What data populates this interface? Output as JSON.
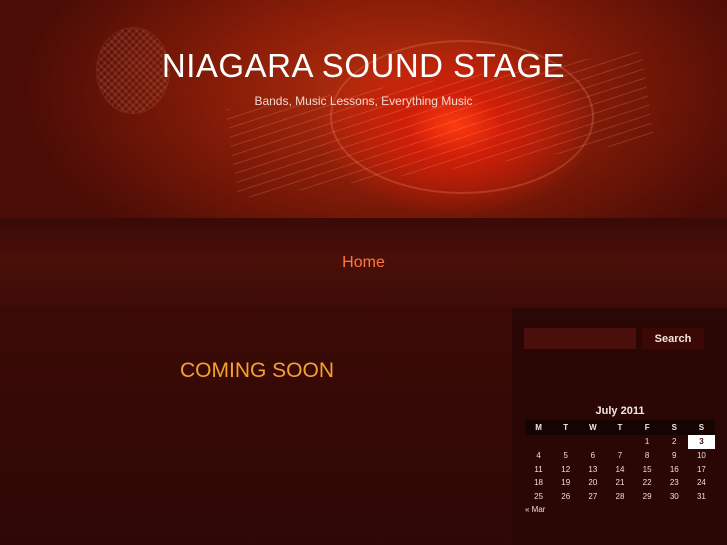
{
  "site": {
    "title": "NIAGARA SOUND STAGE",
    "tagline": "Bands, Music Lessons, Everything Music"
  },
  "nav": {
    "home_label": "Home"
  },
  "main": {
    "heading": "COMING SOON"
  },
  "search": {
    "button_label": "Search",
    "value": ""
  },
  "calendar": {
    "caption": "July 2011",
    "weekdays": [
      "M",
      "T",
      "W",
      "T",
      "F",
      "S",
      "S"
    ],
    "weeks": [
      [
        "",
        "",
        "",
        "",
        "1",
        "2",
        "3"
      ],
      [
        "4",
        "5",
        "6",
        "7",
        "8",
        "9",
        "10"
      ],
      [
        "11",
        "12",
        "13",
        "14",
        "15",
        "16",
        "17"
      ],
      [
        "18",
        "19",
        "20",
        "21",
        "22",
        "23",
        "24"
      ],
      [
        "25",
        "26",
        "27",
        "28",
        "29",
        "30",
        "31"
      ]
    ],
    "today": "3",
    "prev_link": "« Mar"
  },
  "colors": {
    "accent_orange": "#f5a030",
    "nav_link": "#ff7a3a",
    "background": "#2a0805"
  }
}
